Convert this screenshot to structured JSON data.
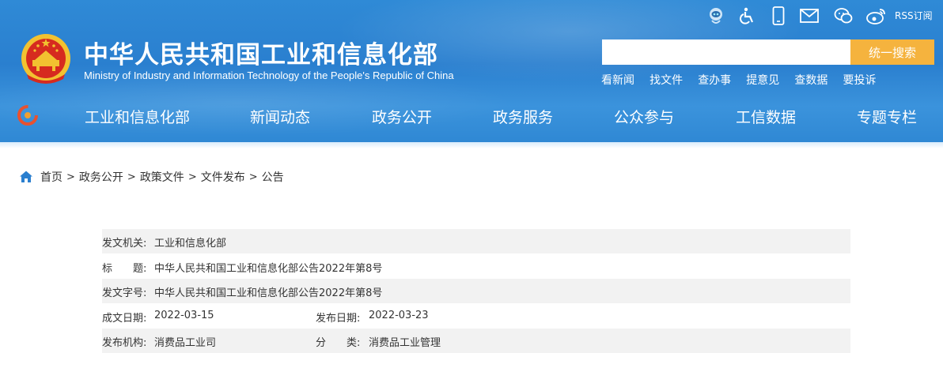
{
  "header": {
    "title_cn": "中华人民共和国工业和信息化部",
    "title_en": "Ministry of Industry and Information Technology of the People's Republic of China",
    "tool_icons": [
      "robot-icon",
      "accessibility-icon",
      "mobile-icon",
      "mail-icon",
      "wechat-icon",
      "weibo-icon"
    ],
    "rss_label": "RSS订阅",
    "search": {
      "placeholder": "",
      "button_label": "统一搜索"
    },
    "quick_links": [
      "看新闻",
      "找文件",
      "查办事",
      "提意见",
      "查数据",
      "要投诉"
    ],
    "colors": {
      "header_bg": "#2f8ad6",
      "search_button": "#f5b33e"
    }
  },
  "nav": {
    "items": [
      "工业和信息化部",
      "新闻动态",
      "政务公开",
      "政务服务",
      "公众参与",
      "工信数据",
      "专题专栏"
    ]
  },
  "breadcrumb": {
    "items": [
      "首页",
      "政务公开",
      "政策文件",
      "文件发布",
      "公告"
    ],
    "separator": ">"
  },
  "document_info": {
    "issuer_label": "发文机关:",
    "issuer_value": "工业和信息化部",
    "title_label": "标　　题:",
    "title_value": "中华人民共和国工业和信息化部公告2022年第8号",
    "doc_no_label": "发文字号:",
    "doc_no_value": "中华人民共和国工业和信息化部公告2022年第8号",
    "written_date_label": "成文日期:",
    "written_date_value": "2022-03-15",
    "publish_date_label": "发布日期:",
    "publish_date_value": "2022-03-23",
    "org_label": "发布机构:",
    "org_value": "消费品工业司",
    "category_label": "分　　类:",
    "category_value": "消费品工业管理"
  }
}
